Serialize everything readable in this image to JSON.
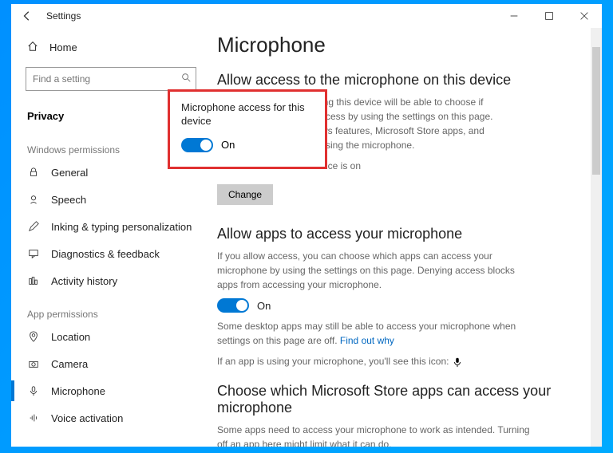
{
  "titlebar": {
    "title": "Settings"
  },
  "sidebar": {
    "home": "Home",
    "searchPlaceholder": "Find a setting",
    "selected": "Privacy",
    "section1": "Windows permissions",
    "items1": [
      "General",
      "Speech",
      "Inking & typing personalization",
      "Diagnostics & feedback",
      "Activity history"
    ],
    "section2": "App permissions",
    "items2": [
      "Location",
      "Camera",
      "Microphone",
      "Voice activation"
    ]
  },
  "main": {
    "h1": "Microphone",
    "h2a": "Allow access to the microphone on this device",
    "p1a": "ing this device will be able to choose if",
    "p1b": "ccess by using the settings on this page.",
    "p1c": "ws features, Microsoft Store apps, and",
    "p1d": "ssing the microphone.",
    "status": "vice is on",
    "change": "Change",
    "h2b": "Allow apps to access your microphone",
    "p2": "If you allow access, you can choose which apps can access your microphone by using the settings on this page. Denying access blocks apps from accessing your microphone.",
    "on": "On",
    "p3a": "Some desktop apps may still be able to access your microphone when settings on this page are off. ",
    "p3link": "Find out why",
    "p4": "If an app is using your microphone, you'll see this icon:",
    "h2c": "Choose which Microsoft Store apps can access your microphone",
    "p5": "Some apps need to access your microphone to work as intended. Turning off an app here might limit what it can do."
  },
  "callout": {
    "title": "Microphone access for this device",
    "state": "On"
  }
}
